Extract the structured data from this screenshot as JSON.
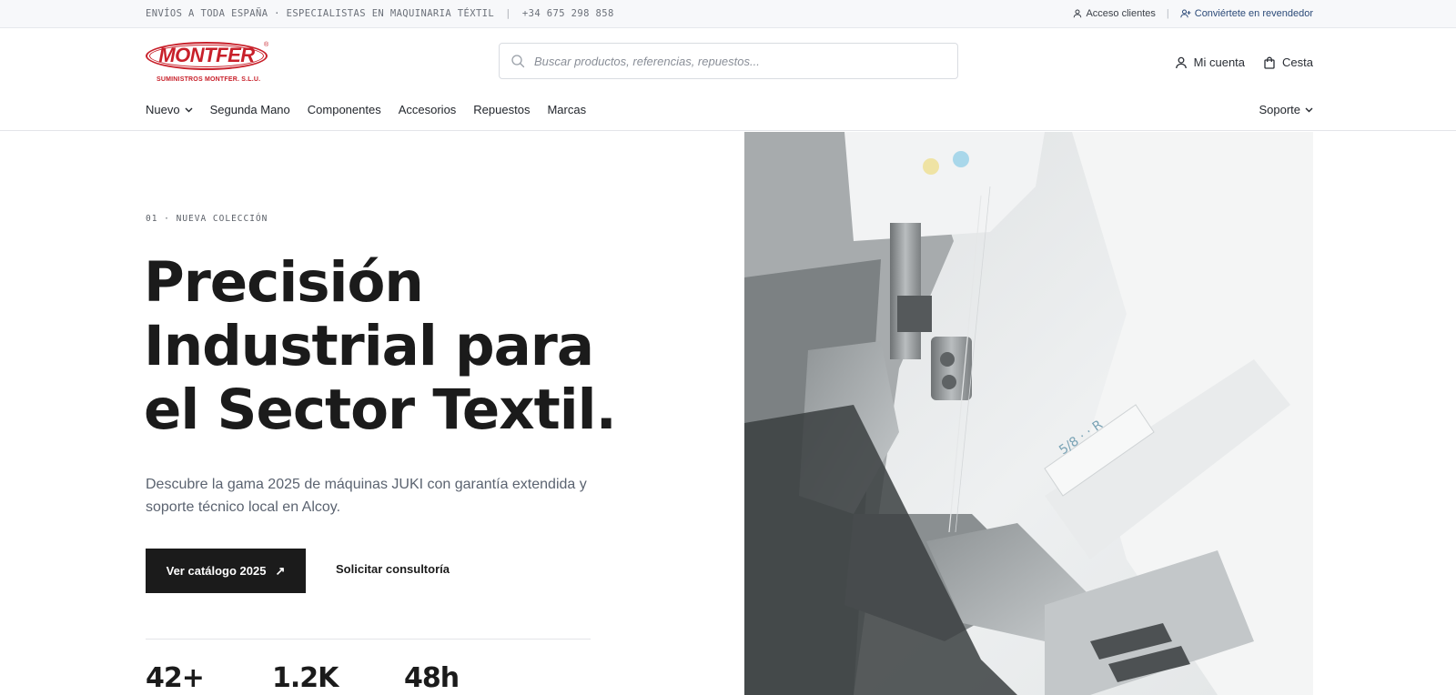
{
  "topbar": {
    "tagline": "ENVÍOS A TODA ESPAÑA · ESPECIALISTAS EN MAQUINARIA TÉXTIL",
    "separator": "|",
    "phone": "+34 675 298 858",
    "client_access": "Acceso clientes",
    "reseller": "Conviértete en revendedor"
  },
  "brand": {
    "logo_text": "MONTFER",
    "logo_sub": "SUMINISTROS MONTFER. S.L.U.",
    "logo_mark": "®",
    "color": "#c8202a"
  },
  "search": {
    "placeholder": "Buscar productos, referencias, repuestos...",
    "value": ""
  },
  "account": {
    "my_account": "Mi cuenta",
    "cart": "Cesta"
  },
  "nav": {
    "items": [
      "Nuevo",
      "Segunda Mano",
      "Componentes",
      "Accesorios",
      "Repuestos",
      "Marcas"
    ],
    "support": "Soporte"
  },
  "hero": {
    "eyebrow": "01 · NUEVA COLECCIÓN",
    "headline": "Precisión Industrial para el Sector Textil.",
    "lead": "Descubre la gama 2025 de máquinas JUKI con garantía extendida y soporte técnico local en Alcoy.",
    "primary_cta": "Ver catálogo 2025",
    "primary_cta_arrow": "↗",
    "secondary_cta": "Solicitar consultoría",
    "image_alt": "sewing-machine-photo"
  },
  "stats": [
    "42+",
    "1.2K",
    "48h"
  ],
  "colors": {
    "accent_dark": "#1b1b1b",
    "link_accent": "#2b4a78",
    "muted": "#5b6370"
  }
}
